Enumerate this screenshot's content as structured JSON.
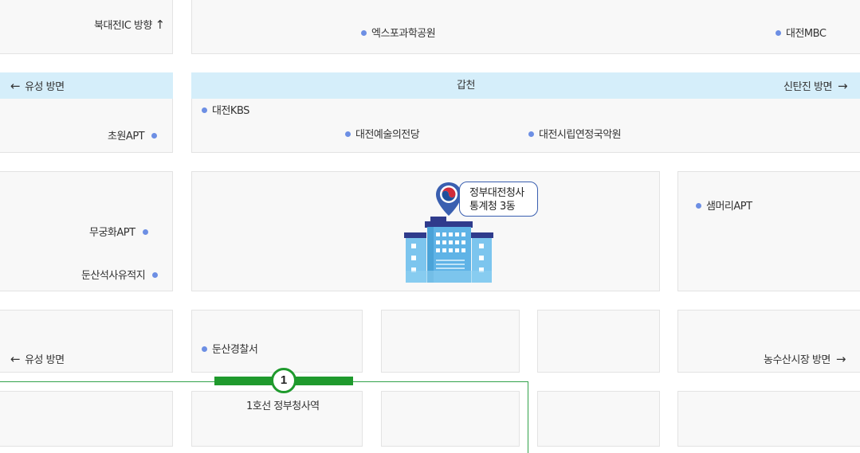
{
  "map": {
    "labels": {
      "north_daejeon_ic": "북대전IC 방향",
      "expo_science_park": "엑스포과학공원",
      "daejeon_mbc": "대전MBC",
      "yuseong_direction_upper": "유성 방면",
      "gapcheon": "갑천",
      "sintanjin_direction": "신탄진 방면",
      "daejeon_kbs": "대전KBS",
      "chowon_apt": "초원APT",
      "daejeon_arts_center": "대전예술의전당",
      "daejeon_gugak_center": "대전시립연정국악원",
      "mugunghwa_apt": "무궁화APT",
      "dunsan_prehistoric_site": "둔산석사유적지",
      "saemmeori_apt": "샘머리APT",
      "dunsan_police": "둔산경찰서",
      "yuseong_direction_lower": "유성 방면",
      "nongsusan_market_direction": "농수산시장 방면",
      "subway_station": "1호선 정부청사역"
    },
    "destination": {
      "line1": "정부대전청사",
      "line2": "통계청 3동"
    },
    "subway": {
      "line_number": "1",
      "color": "#1f9a2d"
    },
    "icons": {
      "arrow_up": "↑",
      "arrow_left": "←",
      "arrow_right": "→",
      "poi_marker": "location-pin-icon"
    },
    "colors": {
      "poi_dot": "#6d8fe4",
      "river": "#d5eefa",
      "block": "#f8f8f8"
    }
  }
}
